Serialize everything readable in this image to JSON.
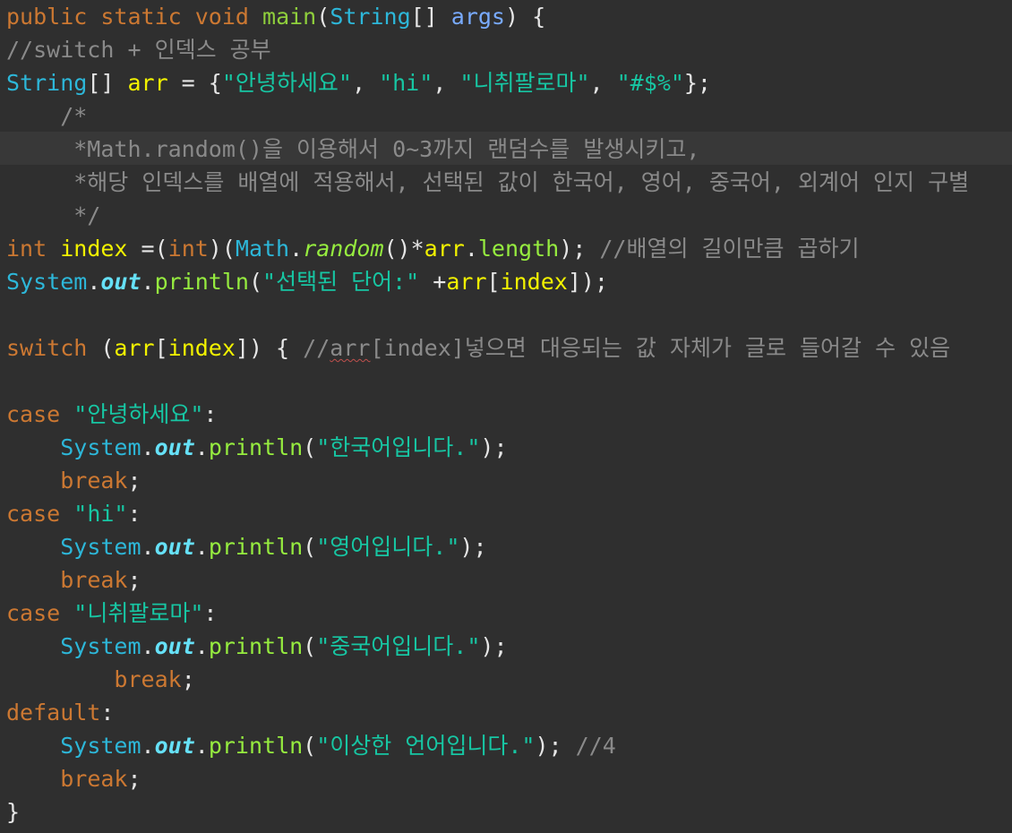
{
  "colors": {
    "background": "#2f2f2f",
    "current_line": "#383838",
    "keyword": "#cc7832",
    "method": "#8fcf3c",
    "type": "#2db7d9",
    "param": "#79abff",
    "string": "#17c6a3",
    "comment": "#8a8a8a",
    "local_var": "#f2f200",
    "static_field": "#66e1f8"
  },
  "code": {
    "l1": {
      "a": "public",
      "b": "static",
      "c": "void",
      "d": "main",
      "e": "(",
      "f": "String",
      "g": "[] ",
      "h": "args",
      "i": ") {"
    },
    "l2": {
      "comment": "//switch + 인덱스 공부"
    },
    "l3": {
      "type": "String",
      "b": "[] ",
      "var": "arr",
      "c": " = {",
      "s1": "\"안녕하세요\"",
      "d": ", ",
      "s2": "\"hi\"",
      "e": ", ",
      "s3": "\"니취팔로마\"",
      "f": ", ",
      "s4": "\"#$%\"",
      "g": "};"
    },
    "l4": {
      "comment": "    /*"
    },
    "l5": {
      "comment": "     *Math.random()을 이용해서 0~3까지 랜덤수를 발생시키고,"
    },
    "l6": {
      "comment": "     *해당 인덱스를 배열에 적용해서, 선택된 값이 한국어, 영어, 중국어, 외계어 인지 구별"
    },
    "l7": {
      "comment": "     */"
    },
    "l8": {
      "kw1": "int",
      "var": "index",
      "a": " =(",
      "kw2": "int",
      "b": ")(",
      "cls": "Math",
      "c": ".",
      "mi": "random",
      "d": "()*",
      "arr": "arr",
      "e": ".",
      "len": "length",
      "f": "); ",
      "comment": "//배열의 길이만큼 곱하기"
    },
    "l9": {
      "cls": "System",
      "a": ".",
      "out": "out",
      "b": ".",
      "m": "println",
      "c": "(",
      "s": "\"선택된 단어:\"",
      "d": " +",
      "arr": "arr",
      "e": "[",
      "idx": "index",
      "f": "]);"
    },
    "l11": {
      "kw": "switch",
      "a": " (",
      "arr": "arr",
      "b": "[",
      "idx": "index",
      "c": "]) { ",
      "cm1": "//",
      "cm2": "arr",
      "cm3": "[index]넣으면 대응되는 값 자체가 글로 들어갈 수 있음"
    },
    "l13": {
      "kw": "case",
      "s": "\"안녕하세요\"",
      "a": ":"
    },
    "l14": {
      "cls": "System",
      "a": ".",
      "out": "out",
      "b": ".",
      "m": "println",
      "c": "(",
      "s": "\"한국어입니다.\"",
      "d": ");"
    },
    "l15": {
      "kw": "break",
      "a": ";"
    },
    "l16": {
      "kw": "case",
      "s": "\"hi\"",
      "a": ":"
    },
    "l17": {
      "cls": "System",
      "a": ".",
      "out": "out",
      "b": ".",
      "m": "println",
      "c": "(",
      "s": "\"영어입니다.\"",
      "d": ");"
    },
    "l18": {
      "kw": "break",
      "a": ";"
    },
    "l19": {
      "kw": "case",
      "s": "\"니취팔로마\"",
      "a": ":"
    },
    "l20": {
      "cls": "System",
      "a": ".",
      "out": "out",
      "b": ".",
      "m": "println",
      "c": "(",
      "s": "\"중국어입니다.\"",
      "d": ");"
    },
    "l21": {
      "kw": "break",
      "a": ";"
    },
    "l22": {
      "kw": "default",
      "a": ":"
    },
    "l23": {
      "cls": "System",
      "a": ".",
      "out": "out",
      "b": ".",
      "m": "println",
      "c": "(",
      "s": "\"이상한 언어입니다.\"",
      "d": "); ",
      "comment": "//4"
    },
    "l24": {
      "kw": "break",
      "a": ";"
    },
    "l25": {
      "a": "}"
    }
  }
}
